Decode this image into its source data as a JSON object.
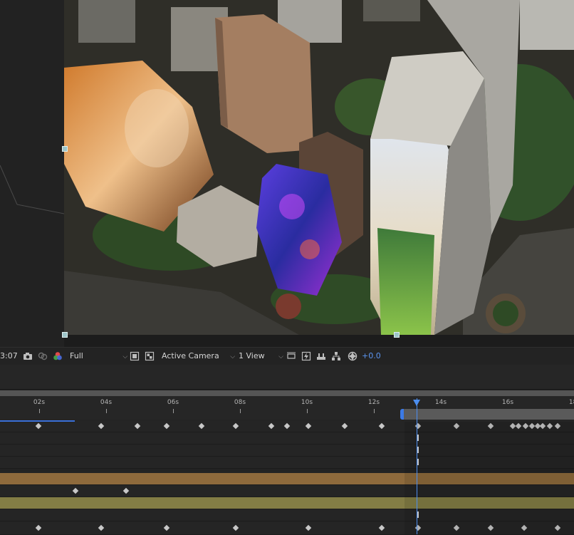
{
  "viewer_toolbar": {
    "timecode_partial": "3:07",
    "resolution": "Full",
    "camera": "Active Camera",
    "view_layout": "1 View",
    "exposure_value": "+0.0"
  },
  "timeline": {
    "ruler_labels": [
      "02s",
      "04s",
      "06s",
      "08s",
      "10s",
      "12s",
      "14s",
      "16s",
      "18s"
    ],
    "bar_colors": {
      "orange": "#8e6a3c",
      "olive": "#837d45",
      "accent": "#4c8ef0"
    }
  }
}
